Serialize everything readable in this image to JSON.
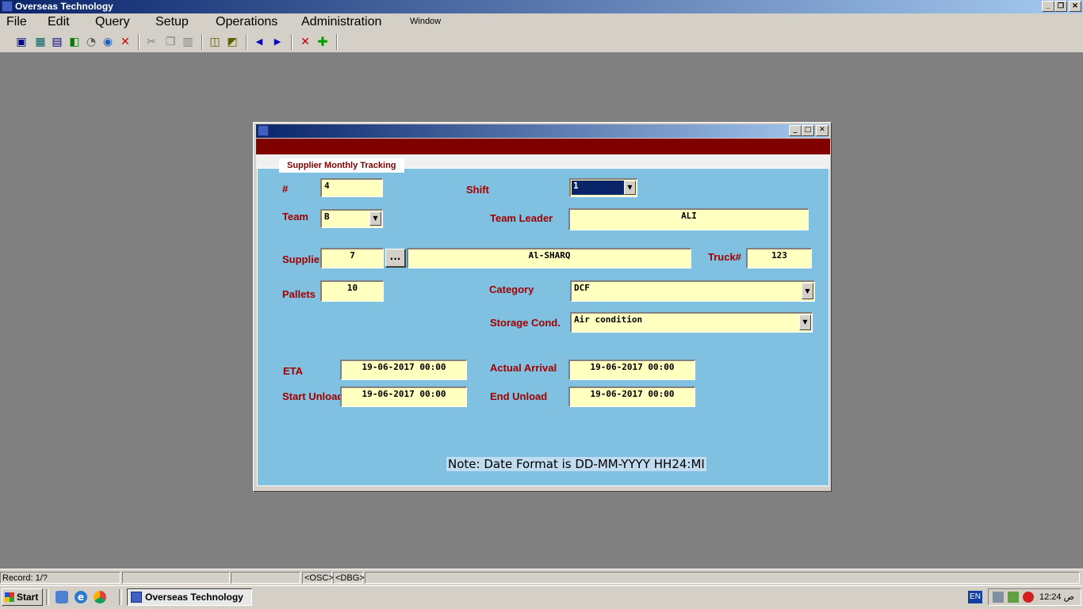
{
  "app": {
    "title": "Overseas Technology"
  },
  "menu": [
    "File",
    "Edit",
    "Query",
    "Setup",
    "Operations",
    "Administration",
    "Window"
  ],
  "toolbar_icons": [
    "save-icon",
    "calculator-icon",
    "report-icon",
    "exit-icon",
    "print-icon",
    "globe-icon",
    "delete-icon",
    "cut-icon",
    "copy-icon",
    "paste-icon",
    "query-icon",
    "query-run-icon",
    "prev-record-icon",
    "next-record-icon",
    "delete-record-icon",
    "insert-record-icon"
  ],
  "form": {
    "tab": "Supplier Monthly Tracking",
    "num_label": "#",
    "num_value": "4",
    "shift_label": "Shift",
    "shift_value": "1",
    "team_label": "Team",
    "team_value": "B",
    "team_leader_label": "Team Leader",
    "team_leader_value": "ALI",
    "supplier_label": "Supplier",
    "supplier_code": "7",
    "supplier_lov": "...",
    "supplier_name": "Al-SHARQ",
    "truck_label": "Truck#",
    "truck_value": "123",
    "pallets_label": "Pallets",
    "pallets_value": "10",
    "category_label": "Category",
    "category_value": "DCF",
    "storage_label": "Storage Cond.",
    "storage_value": "Air condition",
    "eta_label": "ETA",
    "eta_value": "19-06-2017 00:00",
    "actual_arrival_label": "Actual Arrival",
    "actual_arrival_value": "19-06-2017 00:00",
    "start_unload_label": "Start Unload",
    "start_unload_value": "19-06-2017 00:00",
    "end_unload_label": "End Unload",
    "end_unload_value": "19-06-2017 00:00",
    "note": "Note: Date Format is DD-MM-YYYY HH24:MI"
  },
  "status": {
    "record": "Record: 1/?",
    "osc": "<OSC>",
    "dbg": "<DBG>"
  },
  "taskbar": {
    "start": "Start",
    "task": "Overseas Technology",
    "lang": "EN",
    "clock": "12:24 ص"
  },
  "colors": {
    "title_start": "#0a246a",
    "title_end": "#a6caf0",
    "panel": "#80c0e0",
    "field": "#ffffc0",
    "label": "#a00000",
    "banner": "#800000"
  }
}
